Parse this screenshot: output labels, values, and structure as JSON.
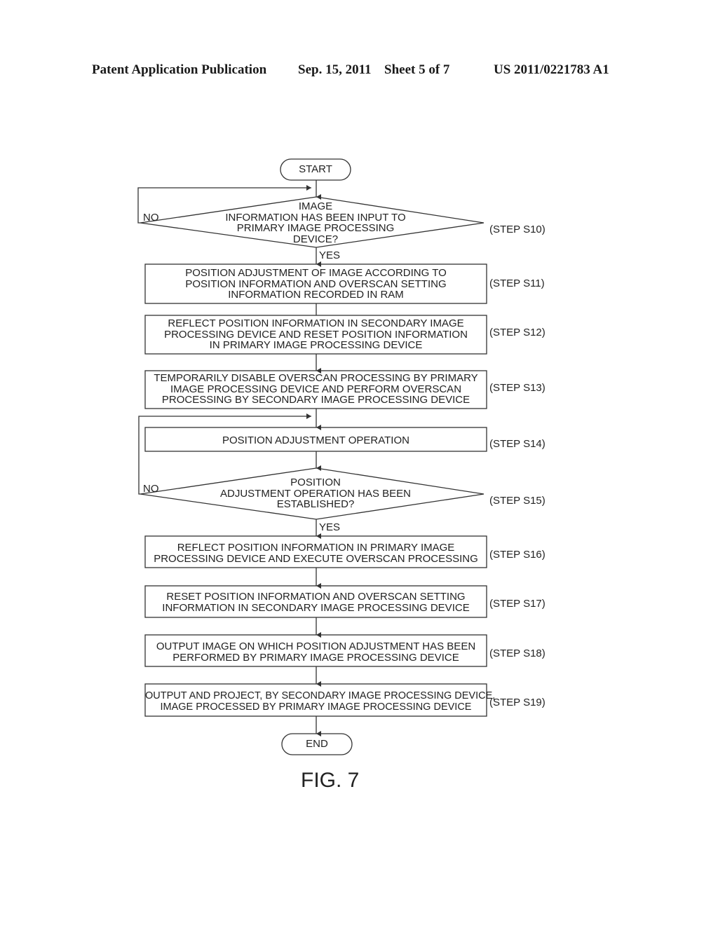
{
  "header": {
    "publication": "Patent Application Publication",
    "date": "Sep. 15, 2011",
    "sheet": "Sheet 5 of 7",
    "number": "US 2011/0221783 A1"
  },
  "flowchart": {
    "start": "START",
    "end": "END",
    "steps": [
      {
        "id": "S10",
        "type": "decision",
        "lines": [
          "IMAGE",
          "INFORMATION HAS BEEN INPUT TO",
          "PRIMARY IMAGE PROCESSING",
          "DEVICE?"
        ],
        "label": "(STEP S10)",
        "no_label": "NO",
        "yes_label": "YES"
      },
      {
        "id": "S11",
        "type": "process",
        "lines": [
          "POSITION ADJUSTMENT OF IMAGE ACCORDING TO",
          "POSITION INFORMATION AND OVERSCAN SETTING",
          "INFORMATION RECORDED IN RAM"
        ],
        "label": "(STEP S11)"
      },
      {
        "id": "S12",
        "type": "process",
        "lines": [
          "REFLECT POSITION INFORMATION IN SECONDARY IMAGE",
          "PROCESSING DEVICE AND RESET POSITION INFORMATION",
          "IN PRIMARY IMAGE PROCESSING DEVICE"
        ],
        "label": "(STEP S12)"
      },
      {
        "id": "S13",
        "type": "process",
        "lines": [
          "TEMPORARILY DISABLE OVERSCAN PROCESSING BY PRIMARY",
          "IMAGE PROCESSING DEVICE AND PERFORM OVERSCAN",
          "PROCESSING BY SECONDARY IMAGE PROCESSING DEVICE"
        ],
        "label": "(STEP S13)"
      },
      {
        "id": "S14",
        "type": "process",
        "lines": [
          "POSITION ADJUSTMENT OPERATION"
        ],
        "label": "(STEP S14)"
      },
      {
        "id": "S15",
        "type": "decision",
        "lines": [
          "POSITION",
          "ADJUSTMENT OPERATION HAS BEEN",
          "ESTABLISHED?"
        ],
        "label": "(STEP S15)",
        "no_label": "NO",
        "yes_label": "YES"
      },
      {
        "id": "S16",
        "type": "process",
        "lines": [
          "REFLECT POSITION INFORMATION IN PRIMARY IMAGE",
          "PROCESSING DEVICE AND EXECUTE OVERSCAN PROCESSING"
        ],
        "label": "(STEP S16)"
      },
      {
        "id": "S17",
        "type": "process",
        "lines": [
          "RESET POSITION INFORMATION AND OVERSCAN SETTING",
          "INFORMATION IN SECONDARY IMAGE PROCESSING DEVICE"
        ],
        "label": "(STEP S17)"
      },
      {
        "id": "S18",
        "type": "process",
        "lines": [
          "OUTPUT IMAGE ON WHICH POSITION ADJUSTMENT HAS BEEN",
          "PERFORMED BY PRIMARY IMAGE PROCESSING DEVICE"
        ],
        "label": "(STEP S18)"
      },
      {
        "id": "S19",
        "type": "process",
        "lines": [
          "OUTPUT AND PROJECT, BY SECONDARY IMAGE PROCESSING DEVICE,",
          "IMAGE PROCESSED BY PRIMARY IMAGE PROCESSING DEVICE"
        ],
        "label": "(STEP S19)"
      }
    ]
  },
  "figure_label": "FIG. 7"
}
